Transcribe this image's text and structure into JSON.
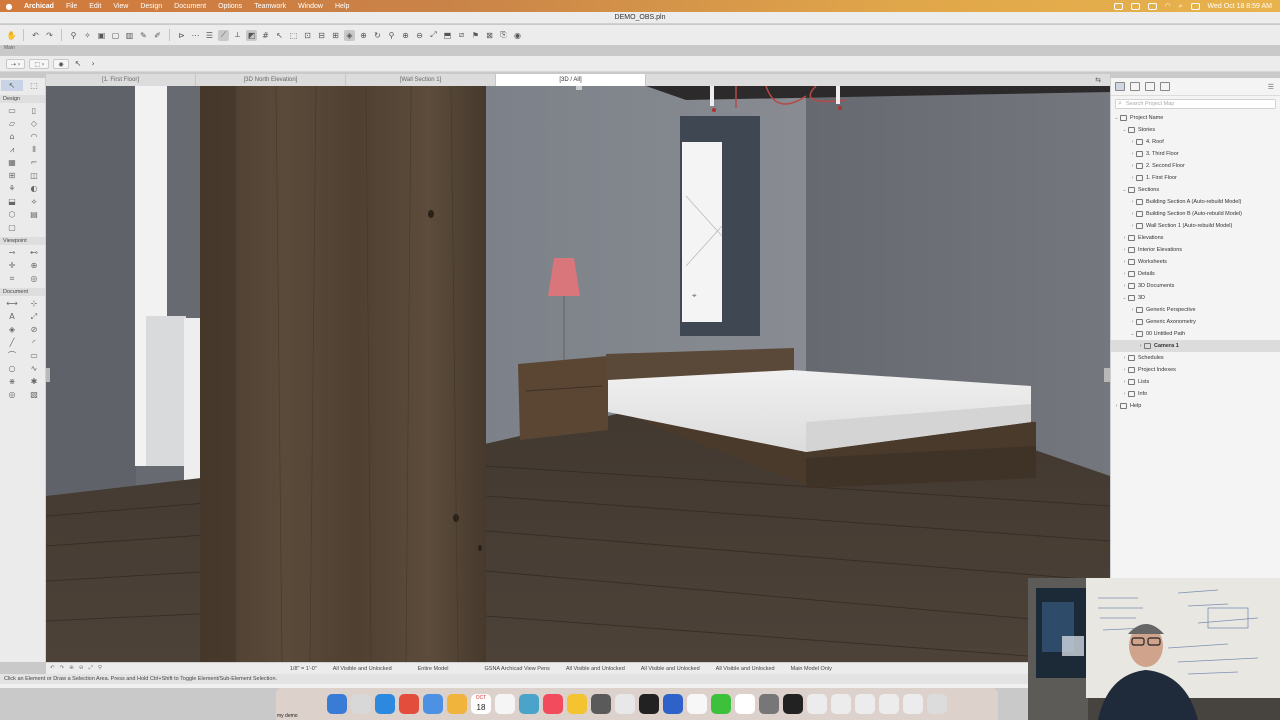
{
  "menubar": {
    "app_name": "Archicad",
    "items": [
      "File",
      "Edit",
      "View",
      "Design",
      "Document",
      "Options",
      "Teamwork",
      "Window",
      "Help"
    ],
    "clock": "Wed Oct 18  8:59 AM"
  },
  "window": {
    "title": "DEMO_OBS.pln"
  },
  "toolbar": {
    "label": "Main"
  },
  "tabs": [
    {
      "label": "[1. First Floor]",
      "active": false
    },
    {
      "label": "[3D North Elevation]",
      "active": false
    },
    {
      "label": "[Wall Section 1]",
      "active": false
    },
    {
      "label": "[3D / All]",
      "active": true
    }
  ],
  "toolbox": {
    "sections": [
      "Design",
      "Viewpoint",
      "Document"
    ]
  },
  "navigator": {
    "search_placeholder": "Search Project Map",
    "tree": [
      {
        "label": "Project Name",
        "depth": 0,
        "expanded": true
      },
      {
        "label": "Stories",
        "depth": 1,
        "expanded": true
      },
      {
        "label": "4. Roof",
        "depth": 2
      },
      {
        "label": "3. Third Floor",
        "depth": 2
      },
      {
        "label": "2. Second Floor",
        "depth": 2
      },
      {
        "label": "1. First Floor",
        "depth": 2
      },
      {
        "label": "Sections",
        "depth": 1,
        "expanded": true
      },
      {
        "label": "Building Section A (Auto-rebuild Model)",
        "depth": 2
      },
      {
        "label": "Building Section B (Auto-rebuild Model)",
        "depth": 2
      },
      {
        "label": "Wall Section 1 (Auto-rebuild Model)",
        "depth": 2
      },
      {
        "label": "Elevations",
        "depth": 1
      },
      {
        "label": "Interior Elevations",
        "depth": 1
      },
      {
        "label": "Worksheets",
        "depth": 1
      },
      {
        "label": "Details",
        "depth": 1
      },
      {
        "label": "3D Documents",
        "depth": 1
      },
      {
        "label": "3D",
        "depth": 1,
        "expanded": true
      },
      {
        "label": "Generic Perspective",
        "depth": 2
      },
      {
        "label": "Generic Axonometry",
        "depth": 2
      },
      {
        "label": "00 Untitled Path",
        "depth": 2,
        "expanded": true
      },
      {
        "label": "Camera 1",
        "depth": 3,
        "selected": true
      },
      {
        "label": "Schedules",
        "depth": 1
      },
      {
        "label": "Project Indexes",
        "depth": 1
      },
      {
        "label": "Lists",
        "depth": 1
      },
      {
        "label": "Info",
        "depth": 1
      },
      {
        "label": "Help",
        "depth": 0
      }
    ]
  },
  "quick_options": {
    "scale": "1/8\"",
    "scale_value": "1'-0\"",
    "layers_1": "All Visible and Unlocked",
    "model_view": "Entire Model",
    "pen_set": "GSNA Archicad View Pens",
    "layers_2": "All Visible and Unlocked",
    "layers_3": "All Visible and Unlocked",
    "layers_4": "All Visible and Unlocked",
    "model_only": "Main Model Only"
  },
  "status_text": "Click an Element or Draw a Selection Area. Press and Hold Ctrl+Shift to Toggle Element/Sub-Element Selection.",
  "dock": {
    "caption": "my demo",
    "calendar_month": "OCT",
    "calendar_day": "18"
  },
  "colors": {
    "menubar_start": "#d27a3c",
    "menubar_end": "#e8b34d",
    "viewport_wall": "#6c7177",
    "floor": "#4a4036",
    "selection_highlight": "#dcdcdc"
  }
}
